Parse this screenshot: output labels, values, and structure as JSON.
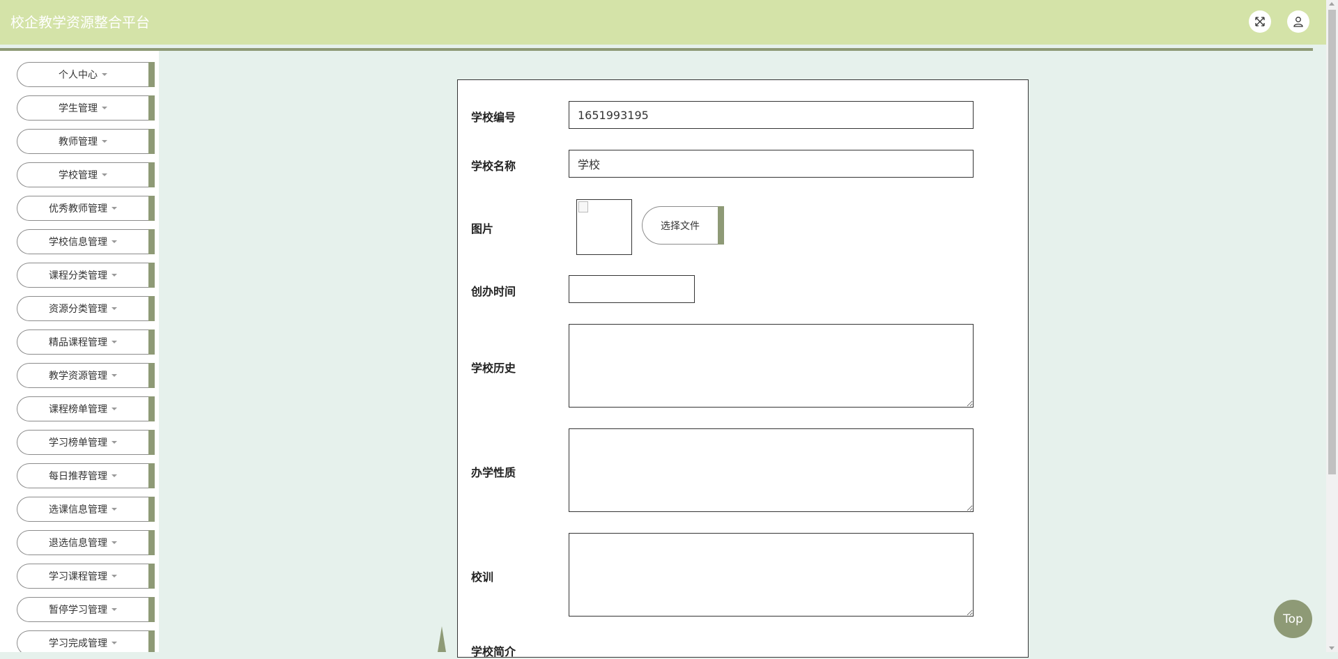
{
  "header": {
    "title": "校企教学资源整合平台"
  },
  "sidebar": {
    "items": [
      {
        "label": "个人中心"
      },
      {
        "label": "学生管理"
      },
      {
        "label": "教师管理"
      },
      {
        "label": "学校管理"
      },
      {
        "label": "优秀教师管理"
      },
      {
        "label": "学校信息管理"
      },
      {
        "label": "课程分类管理"
      },
      {
        "label": "资源分类管理"
      },
      {
        "label": "精品课程管理"
      },
      {
        "label": "教学资源管理"
      },
      {
        "label": "课程榜单管理"
      },
      {
        "label": "学习榜单管理"
      },
      {
        "label": "每日推荐管理"
      },
      {
        "label": "选课信息管理"
      },
      {
        "label": "退选信息管理"
      },
      {
        "label": "学习课程管理"
      },
      {
        "label": "暂停学习管理"
      },
      {
        "label": "学习完成管理"
      }
    ]
  },
  "form": {
    "school_id_label": "学校编号",
    "school_id_value": "1651993195",
    "school_name_label": "学校名称",
    "school_name_value": "学校",
    "image_label": "图片",
    "choose_file_label": "选择文件",
    "founded_label": "创办时间",
    "founded_value": "",
    "history_label": "学校历史",
    "nature_label": "办学性质",
    "motto_label": "校训",
    "intro_label": "学校简介"
  },
  "back_to_top_label": "Top",
  "colors": {
    "header_bg": "#d4e3a8",
    "accent": "#8e9a76",
    "page_bg": "#e6f1ec"
  }
}
